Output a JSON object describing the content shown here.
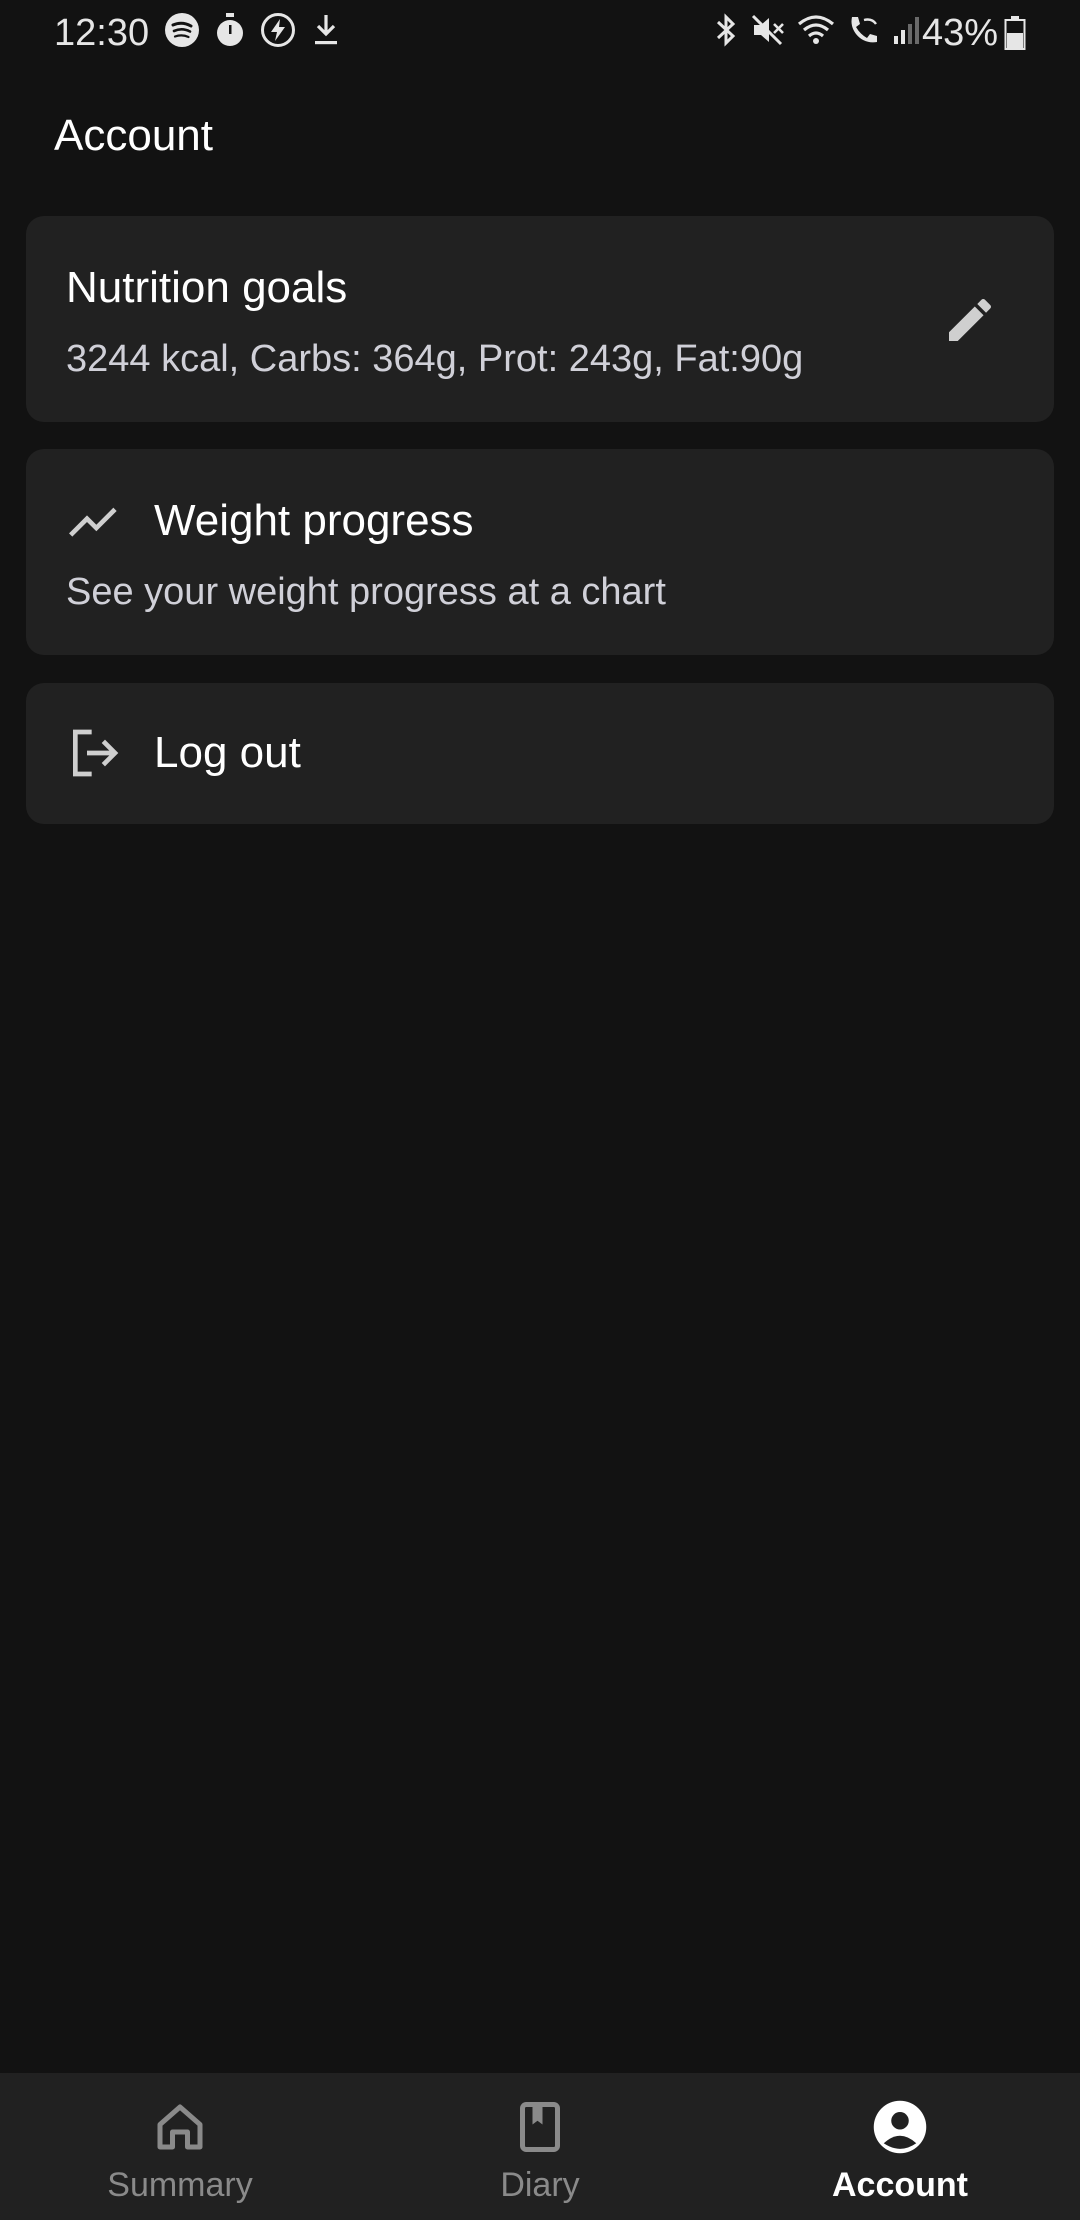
{
  "status_bar": {
    "time": "12:30",
    "battery_percent": "43%",
    "left_icons": [
      "spotify-icon",
      "stopwatch-icon",
      "flash-icon",
      "download-icon"
    ],
    "right_icons": [
      "bluetooth-icon",
      "mute-icon",
      "wifi-icon",
      "wifi-calling-icon",
      "signal-icon",
      "battery-icon"
    ]
  },
  "page": {
    "title": "Account"
  },
  "cards": {
    "nutrition": {
      "title": "Nutrition goals",
      "subtitle": "3244 kcal, Carbs: 364g, Prot: 243g, Fat:90g",
      "action_icon": "edit-icon"
    },
    "weight": {
      "icon": "trending-up-icon",
      "title": "Weight progress",
      "subtitle": "See your weight progress at a chart"
    },
    "logout": {
      "icon": "logout-icon",
      "title": "Log out"
    }
  },
  "bottom_nav": {
    "items": [
      {
        "label": "Summary",
        "icon": "home-icon",
        "active": false
      },
      {
        "label": "Diary",
        "icon": "book-icon",
        "active": false
      },
      {
        "label": "Account",
        "icon": "account-circle-icon",
        "active": true
      }
    ]
  },
  "colors": {
    "background": "#121212",
    "surface": "#212121",
    "text_primary": "#ffffff",
    "text_secondary": "#d0d0d8",
    "nav_inactive": "#8a8a8a"
  }
}
